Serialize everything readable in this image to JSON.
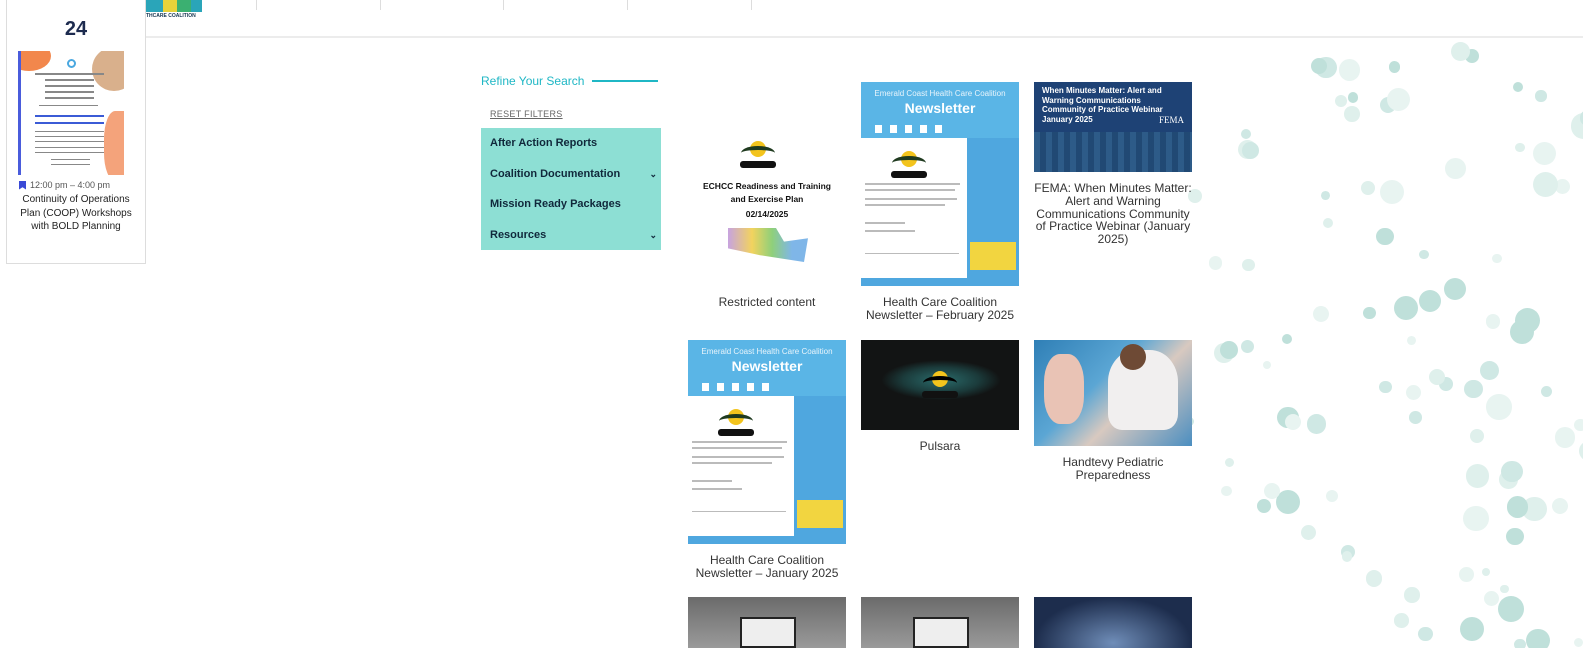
{
  "calendar": {
    "day": "24",
    "event_time": "12:00 pm – 4:00 pm",
    "event_title": "Continuity of Operations Plan (COOP) Workshops with BOLD Planning"
  },
  "header": {
    "logo_text": "THCARE COALITION"
  },
  "sidebar": {
    "refine_label": "Refine Your Search",
    "reset_label": "RESET FILTERS",
    "filters": [
      {
        "label": "After Action Reports",
        "expandable": false
      },
      {
        "label": "Coalition Documentation",
        "expandable": true
      },
      {
        "label": "Mission Ready Packages",
        "expandable": false
      },
      {
        "label": "Resources",
        "expandable": true
      }
    ],
    "chevron": "chevron-down-icon"
  },
  "grid": {
    "echcc": {
      "thumb_title": "ECHCC Readiness and Training and Exercise Plan",
      "thumb_date": "02/14/2025",
      "caption": "Restricted content"
    },
    "newsletter_feb": {
      "thumb_org": "Emerald Coast Health Care Coalition",
      "thumb_title": "Newsletter",
      "caption": "Health Care Coalition Newsletter – February 2025"
    },
    "fema": {
      "thumb_title": "When Minutes Matter: Alert and Warning Communications Community of Practice Webinar January 2025",
      "thumb_logo": "FEMA",
      "caption": "FEMA: When Minutes Matter: Alert and Warning Communications Community of Practice Webinar (January 2025)"
    },
    "newsletter_jan": {
      "thumb_org": "Emerald Coast Health Care Coalition",
      "thumb_title": "Newsletter",
      "caption": "Health Care Coalition Newsletter – January 2025"
    },
    "pulsara": {
      "caption": "Pulsara"
    },
    "handtevy": {
      "caption": "Handtevy Pediatric Preparedness"
    }
  },
  "colors": {
    "accent": "#1fb7c5",
    "filter_bg": "#8ddfd4",
    "newsletter_blue": "#5ab5e6",
    "fema_blue": "#1e4275"
  }
}
